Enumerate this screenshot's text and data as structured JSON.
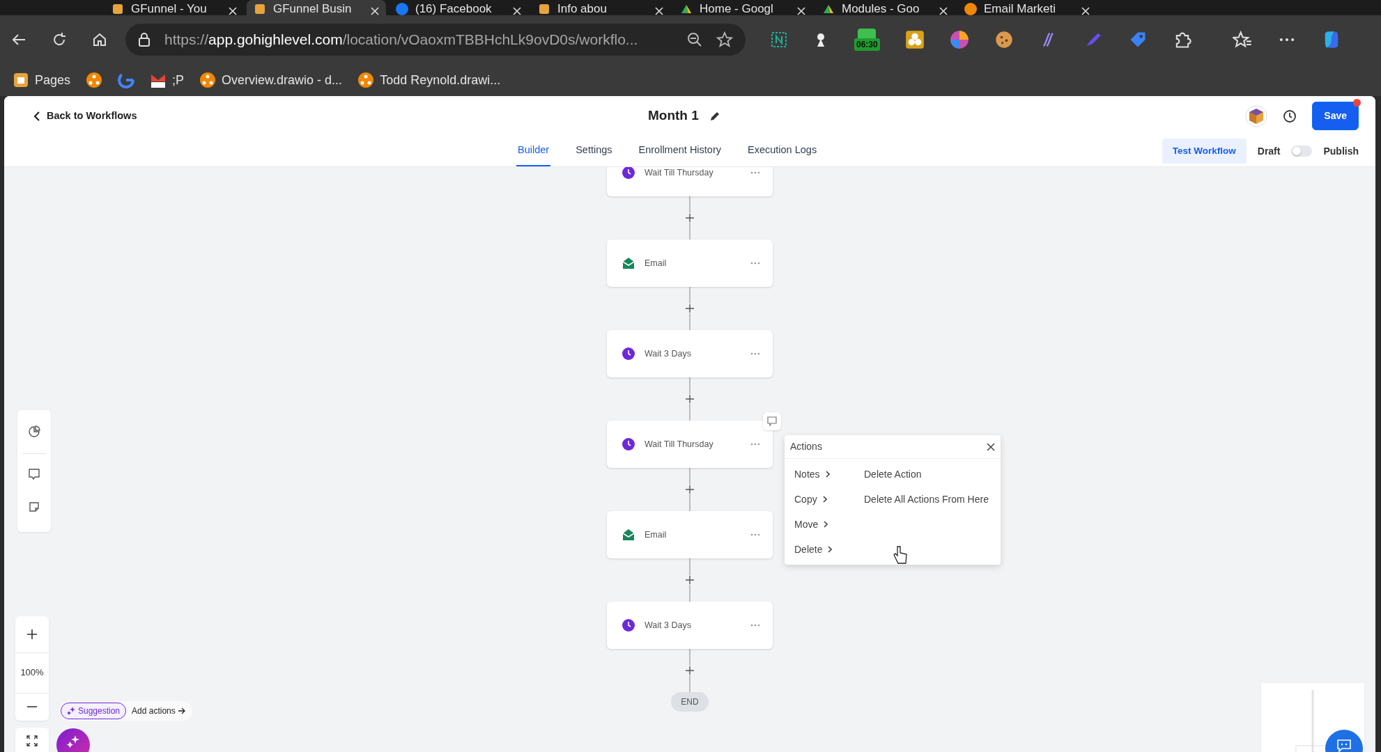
{
  "browser": {
    "tabs": [
      {
        "title": "GFunnel - You",
        "selected": false
      },
      {
        "title": "GFunnel Busin",
        "selected": true
      },
      {
        "title": "(16) Facebook",
        "selected": false
      },
      {
        "title": "Info abou",
        "selected": false
      },
      {
        "title": "Home - Googl",
        "selected": false
      },
      {
        "title": "Modules - Goo",
        "selected": false
      },
      {
        "title": "Email Marketi",
        "selected": false
      }
    ],
    "url": {
      "scheme": "https://",
      "host": "app.gohighlevel.com",
      "path": "/location/vOaoxmTBBHchLk9ovD0s/workflo..."
    },
    "extension_badge": "06:30",
    "bookmarks": [
      "Pages",
      ";P",
      "Overview.drawio - d...",
      "Todd Reynold.drawi..."
    ]
  },
  "header": {
    "back": "Back to Workflows",
    "title": "Month 1",
    "save": "Save",
    "unsaved": true
  },
  "tabs": [
    {
      "label": "Builder",
      "selected": true
    },
    {
      "label": "Settings",
      "selected": false
    },
    {
      "label": "Enrollment History",
      "selected": false
    },
    {
      "label": "Execution Logs",
      "selected": false
    }
  ],
  "test_button": "Test Workflow",
  "draft_label": "Draft",
  "publish": {
    "label": "Publish",
    "on": false
  },
  "flow": {
    "nodes": [
      {
        "kind": "wait",
        "label": "Wait Till Thursday"
      },
      {
        "kind": "email",
        "label": "Email"
      },
      {
        "kind": "wait",
        "label": "Wait 3 Days"
      },
      {
        "kind": "wait",
        "label": "Wait Till Thursday"
      },
      {
        "kind": "email",
        "label": "Email"
      },
      {
        "kind": "wait",
        "label": "Wait 3 Days"
      }
    ],
    "end": "END"
  },
  "context_menu": {
    "title": "Actions",
    "items": [
      "Notes",
      "Copy",
      "Move",
      "Delete"
    ],
    "submenu": [
      "Delete Action",
      "Delete All Actions From Here"
    ]
  },
  "canvas_controls": {
    "zoom": "100%",
    "suggestion": "Suggestion",
    "add_actions": "Add actions"
  }
}
